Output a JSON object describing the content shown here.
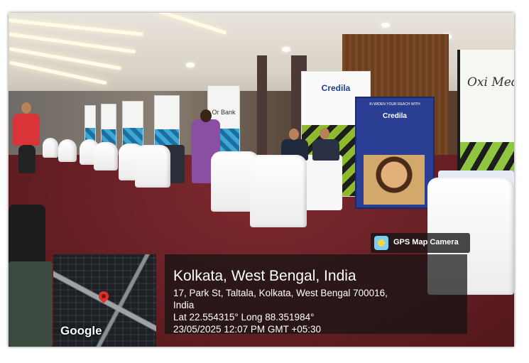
{
  "photo": {
    "banners": {
      "credila_logo": "Credila",
      "blue_banner_logo": "Credila",
      "blue_banner_tagline": "Ki WIDEN YOUR REACH WITH",
      "right_banner_text": "Oxi Med",
      "small_banner_text": "Or Bank"
    }
  },
  "gps_badge": {
    "label": "GPS Map Camera",
    "icon": "gps-map-camera-icon"
  },
  "map": {
    "brand": "Google",
    "pin_icon": "map-pin-icon",
    "pin_color": "#e0302a"
  },
  "location": {
    "title": "Kolkata, West Bengal, India",
    "address_line1": "17, Park St, Taltala, Kolkata, West Bengal 700016,",
    "address_line2": "India",
    "coordinates": "Lat 22.554315° Long 88.351984°",
    "datetime": "23/05/2025 12:07 PM GMT +05:30"
  }
}
